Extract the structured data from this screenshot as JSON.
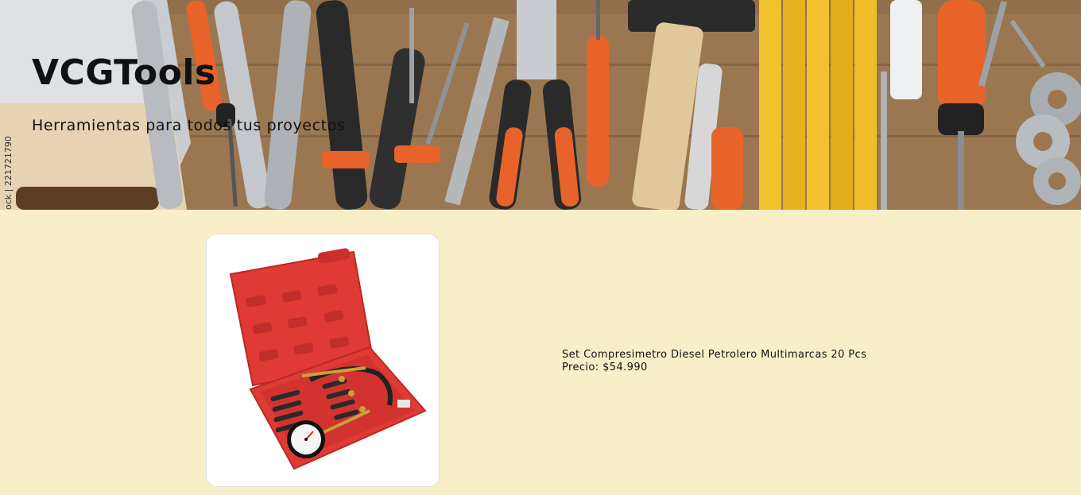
{
  "header": {
    "title": "VCGTools",
    "subtitle": "Herramientas para todos tus proyectos",
    "watermark": "ock | 221721790"
  },
  "product": {
    "name": "Set Compresimetro Diesel Petrolero Multimarcas 20 Pcs",
    "price_label": "Precio:",
    "price": "$54.990"
  },
  "colors": {
    "page_background": "#f8efc8",
    "case_red": "#e03a34",
    "tool_orange": "#e8632a"
  },
  "icons": {
    "product_image": "compression-tester-kit-image",
    "hero_image": "tools-banner-image"
  }
}
